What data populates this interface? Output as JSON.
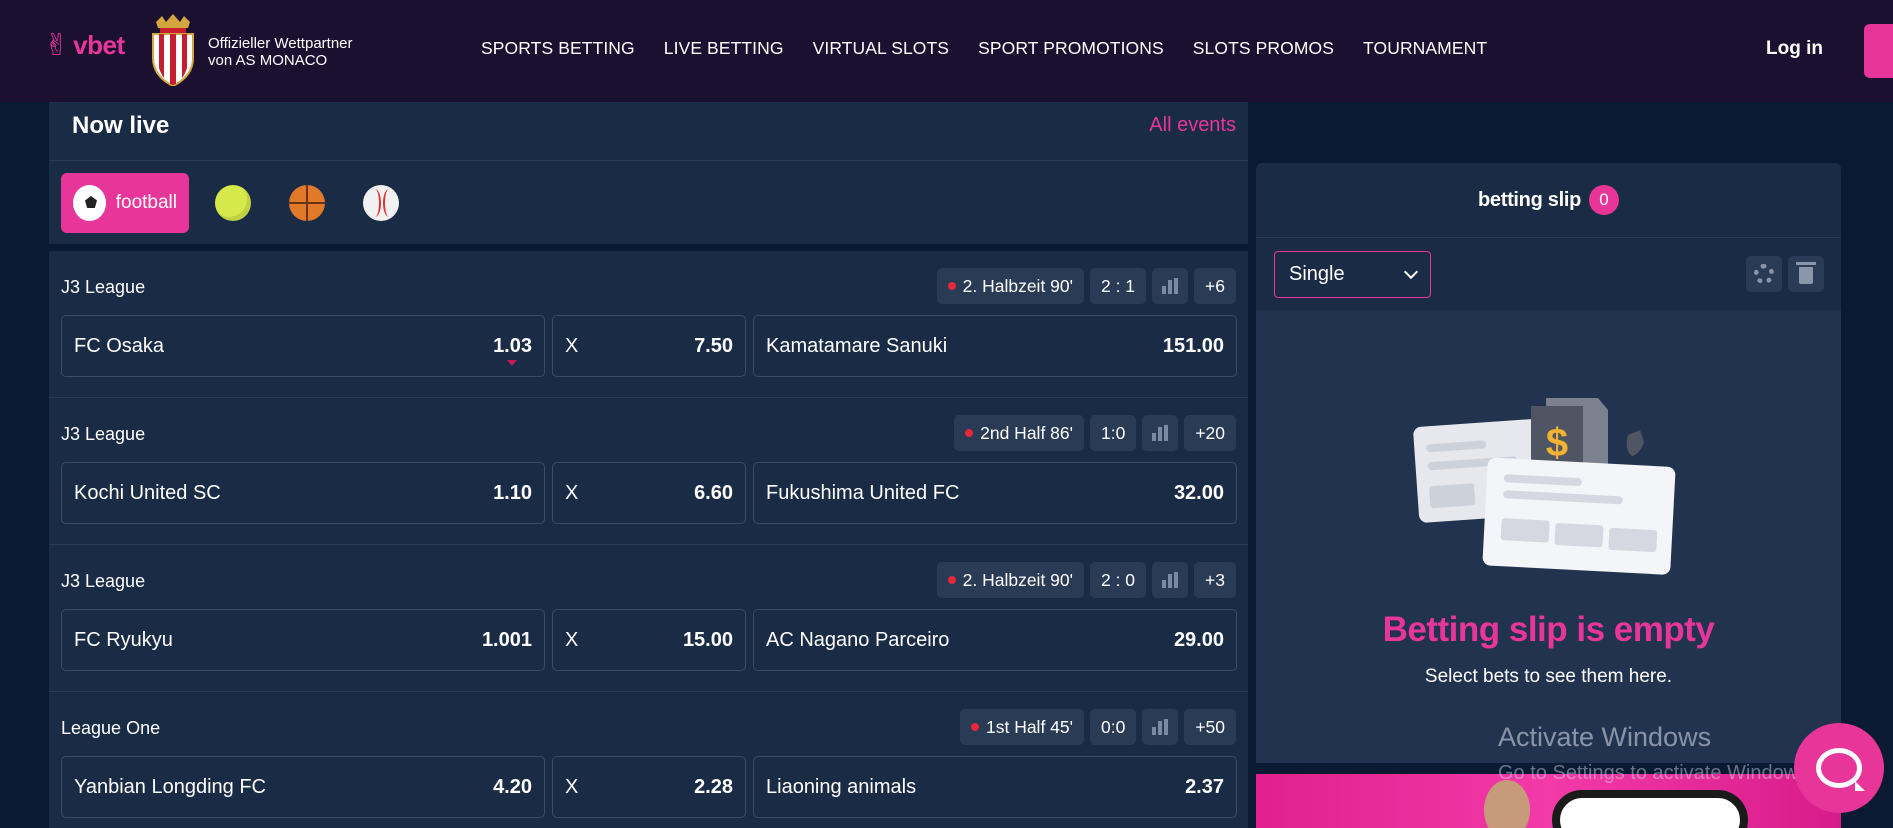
{
  "header": {
    "brand": "vbet",
    "partner_line1": "Offizieller Wettpartner",
    "partner_line2": "von AS MONACO",
    "nav": [
      "SPORTS BETTING",
      "LIVE BETTING",
      "VIRTUAL SLOTS",
      "SPORT PROMOTIONS",
      "SLOTS PROMOS",
      "TOURNAMENT"
    ],
    "login_label": "Log in"
  },
  "live": {
    "title": "Now live",
    "all_events": "All events",
    "sports": [
      {
        "name": "football",
        "label": "football",
        "active": true,
        "icon": "soccer-ball-icon"
      },
      {
        "name": "tennis",
        "label": "",
        "active": false,
        "icon": "tennis-ball-icon"
      },
      {
        "name": "basketball",
        "label": "",
        "active": false,
        "icon": "basketball-icon"
      },
      {
        "name": "baseball",
        "label": "",
        "active": false,
        "icon": "baseball-icon"
      }
    ]
  },
  "events": [
    {
      "league": "J3 League",
      "status": "2. Halbzeit 90'",
      "score": "2 : 1",
      "more": "+6",
      "home": "FC Osaka",
      "home_odd": "1.03",
      "draw": "X",
      "draw_odd": "7.50",
      "away": "Kamatamare Sanuki",
      "away_odd": "151.00",
      "home_trend": "down"
    },
    {
      "league": "J3 League",
      "status": "2nd Half 86'",
      "score": "1:0",
      "more": "+20",
      "home": "Kochi United SC",
      "home_odd": "1.10",
      "draw": "X",
      "draw_odd": "6.60",
      "away": "Fukushima United FC",
      "away_odd": "32.00"
    },
    {
      "league": "J3 League",
      "status": "2. Halbzeit 90'",
      "score": "2 : 0",
      "more": "+3",
      "home": "FC Ryukyu",
      "home_odd": "1.001",
      "draw": "X",
      "draw_odd": "15.00",
      "away": "AC Nagano Parceiro",
      "away_odd": "29.00"
    },
    {
      "league": "League One",
      "status": "1st Half 45'",
      "score": "0:0",
      "more": "+50",
      "home": "Yanbian Longding FC",
      "home_odd": "4.20",
      "draw": "X",
      "draw_odd": "2.28",
      "away": "Liaoning animals",
      "away_odd": "2.37"
    }
  ],
  "slip": {
    "title": "betting slip",
    "count": "0",
    "mode": "Single",
    "empty_title": "Betting slip is empty",
    "empty_sub": "Select bets to see them here."
  },
  "watermark": {
    "line1": "Activate Windows",
    "line2": "Go to Settings to activate Windows."
  },
  "colors": {
    "accent": "#e8359a",
    "header_bg": "#1c1030",
    "panel_bg": "#1a2b45",
    "page_bg": "#0b1a33"
  }
}
